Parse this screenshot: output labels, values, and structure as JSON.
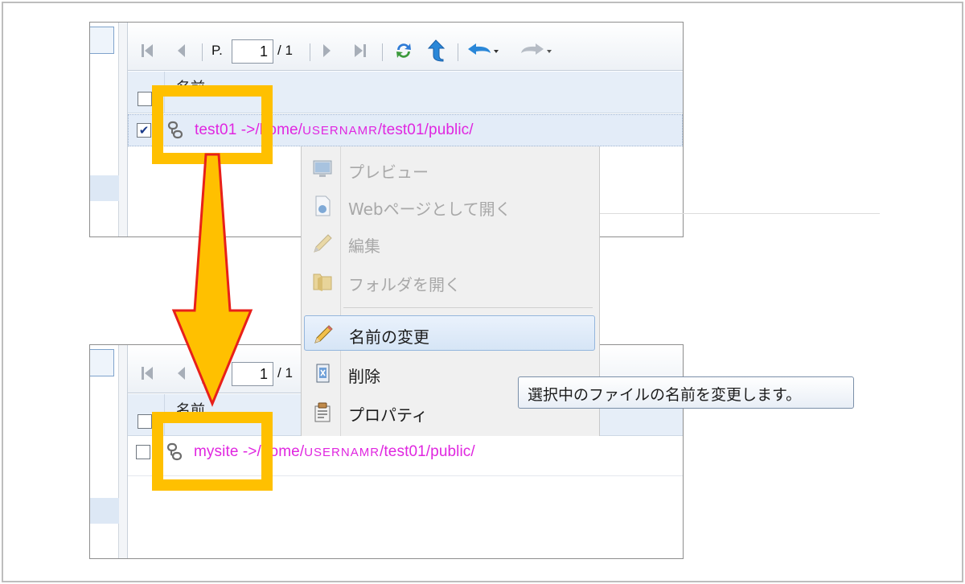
{
  "toolbar": {
    "page_prefix": "P.",
    "current_page": "1",
    "total_pages": "/ 1",
    "icons": [
      "first-page-icon",
      "prev-page-icon",
      "next-page-icon",
      "last-page-icon",
      "refresh-icon",
      "up-folder-icon",
      "undo-dropdown-icon",
      "redo-dropdown-icon"
    ]
  },
  "grid": {
    "name_column_header": "名前"
  },
  "before_row": {
    "checked": true,
    "link_name": "test01",
    "arrow": " ->",
    "path_prefix": "/home/",
    "user": "USERNAMR",
    "path_suffix": "/test01/public/"
  },
  "after_row": {
    "checked": false,
    "link_name": "mysite",
    "arrow": " ->",
    "path_prefix": "/home/",
    "user": "USERNAMR",
    "path_suffix": "/test01/public/"
  },
  "context_menu": {
    "items": [
      {
        "label": "プレビュー",
        "icon": "monitor-icon",
        "enabled": false
      },
      {
        "label": "Webページとして開く",
        "icon": "web-page-icon",
        "enabled": false
      },
      {
        "label": "編集",
        "icon": "pencil-icon",
        "enabled": false
      },
      {
        "label": "フォルダを開く",
        "icon": "folder-icon",
        "enabled": false
      },
      {
        "label": "名前の変更",
        "icon": "pencil-icon",
        "enabled": true,
        "highlighted": true
      },
      {
        "label": "削除",
        "icon": "delete-icon",
        "enabled": true
      },
      {
        "label": "プロパティ",
        "icon": "properties-icon",
        "enabled": true
      }
    ]
  },
  "tooltip": {
    "text": "選択中のファイルの名前を変更します。"
  },
  "colors": {
    "highlight_box": "#ffc000",
    "arrow_fill": "#ffc000",
    "arrow_stroke": "#e8201a",
    "link_text": "#e026e0",
    "selected_row": "#e3ecf8"
  }
}
